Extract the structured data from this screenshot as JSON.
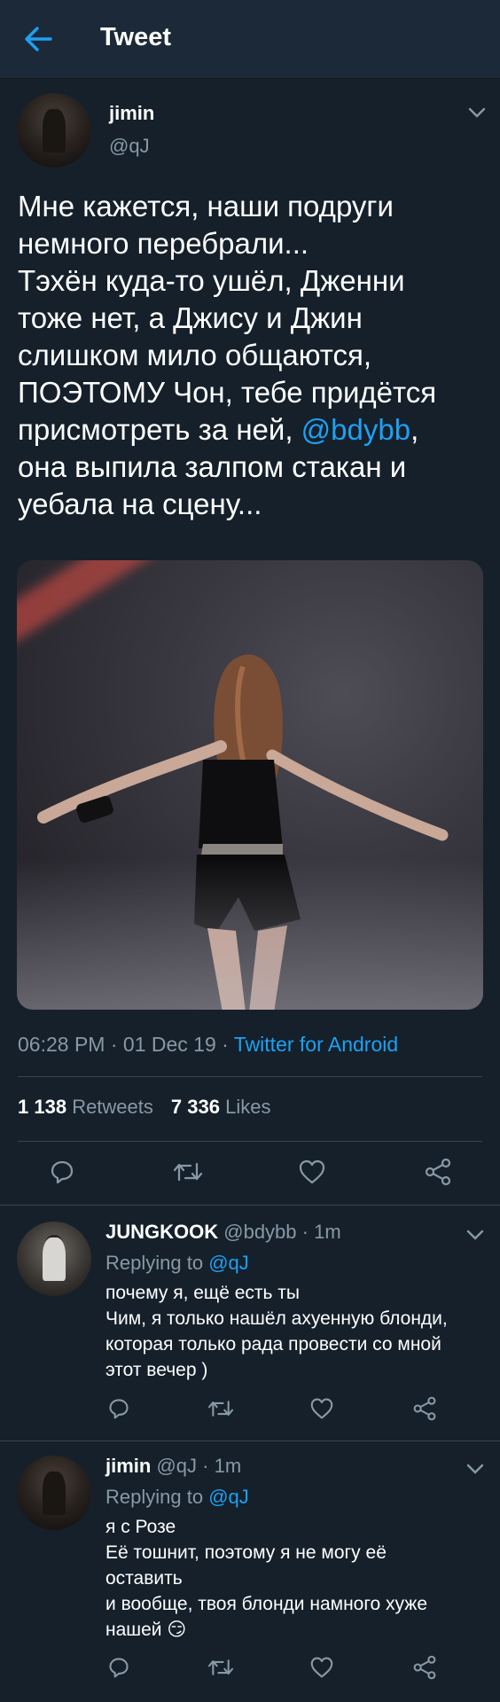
{
  "header": {
    "title": "Tweet"
  },
  "tweet": {
    "author_name": "jimin",
    "author_handle": "@qJ",
    "text_before": "Мне кажется, наши подруги\nнемного перебрали...\nТэхён куда-то ушёл, Дженни\nтоже нет, а Джису и Джин\nслишком мило общаются,\nПОЭТОМУ Чон, тебе придётся\nприсмотреть за ней, ",
    "mention": "@bdybb",
    "text_after": ",\nона выпила залпом стакан и\nуебала на сцену...",
    "time": "06:28 PM",
    "date": "01 Dec 19",
    "source": "Twitter for Android",
    "retweets_count": "1 138",
    "retweets_label": "Retweets",
    "likes_count": "7 336",
    "likes_label": "Likes"
  },
  "replies": [
    {
      "name": "JUNGKOOK",
      "handle": "@bdybb",
      "age": "1m",
      "replying_label": "Replying to",
      "replying_to": "@qJ",
      "text": "почему я, ещё есть ты\nЧим, я только нашёл ахуенную блонди,\nкоторая только рада провести со мной\nэтот вечер )"
    },
    {
      "name": "jimin",
      "handle": "@qJ",
      "age": "1m",
      "replying_label": "Replying to",
      "replying_to": "@qJ",
      "text": "я с Розе\nЕё тошнит, поэтому я не могу её\nоставить\nи вообще, твоя блонди намного хуже\nнашей ",
      "emoji": "😏"
    }
  ],
  "icons": {
    "back": "arrow-left-icon",
    "more": "chevron-down-icon",
    "reply": "reply-icon",
    "retweet": "retweet-icon",
    "like": "heart-icon",
    "share": "share-icon"
  },
  "colors": {
    "background": "#15202b",
    "header": "#1c2938",
    "accent": "#1da1f2",
    "muted": "#8899a6",
    "divider": "#38444d"
  }
}
